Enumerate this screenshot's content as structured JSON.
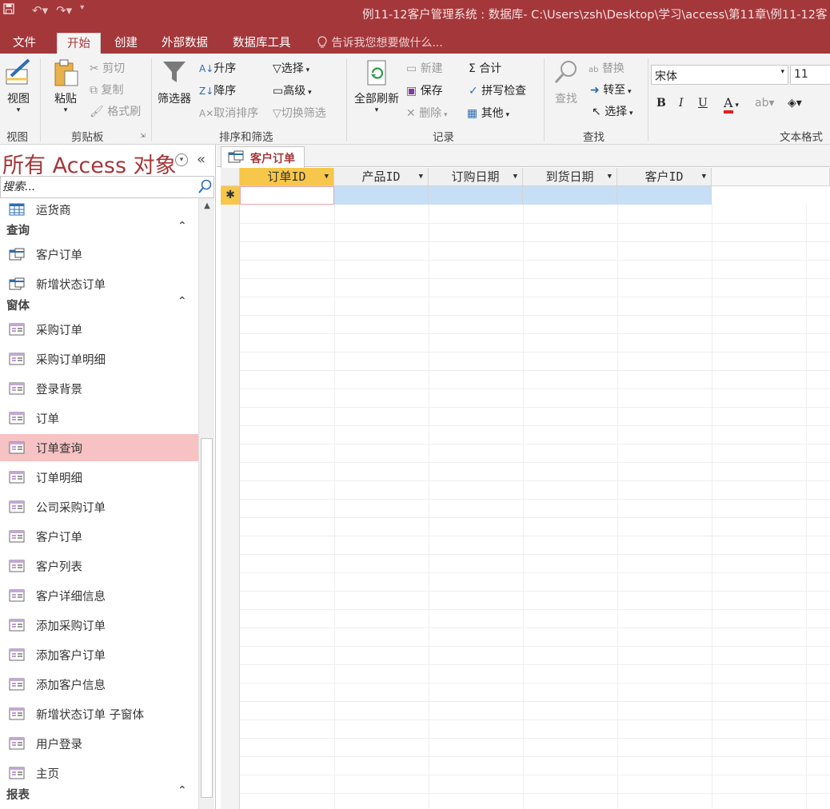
{
  "window": {
    "title": "例11-12客户管理系统 : 数据库- C:\\Users\\zsh\\Desktop\\学习\\access\\第11章\\例11-12客"
  },
  "tabs": [
    {
      "label": "文件"
    },
    {
      "label": "开始"
    },
    {
      "label": "创建"
    },
    {
      "label": "外部数据"
    },
    {
      "label": "数据库工具"
    }
  ],
  "tell_me": "告诉我您想要做什么...",
  "ribbon": {
    "view": {
      "label": "视图",
      "group": "视图"
    },
    "clipboard": {
      "paste": "粘贴",
      "cut": "剪切",
      "copy": "复制",
      "format_painter": "格式刷",
      "group": "剪贴板"
    },
    "sort_filter": {
      "filter": "筛选器",
      "ascending": "升序",
      "descending": "降序",
      "clear_sort": "取消排序",
      "selection": "选择",
      "advanced": "高级",
      "toggle_filter": "切换筛选",
      "group": "排序和筛选"
    },
    "records": {
      "refresh_all": "全部刷新",
      "new": "新建",
      "save": "保存",
      "delete": "删除",
      "totals": "合计",
      "spelling": "拼写检查",
      "more": "其他",
      "group": "记录"
    },
    "find": {
      "find": "查找",
      "replace": "替换",
      "goto": "转至",
      "select": "选择",
      "group": "查找"
    },
    "text_format": {
      "font": "宋体",
      "size": "11",
      "bold": "B",
      "italic": "I",
      "underline": "U",
      "font_color_letter": "A",
      "group": "文本格式"
    }
  },
  "nav": {
    "title": "所有 Access 对象",
    "collapse": "«",
    "search_placeholder": "搜索...",
    "top_item": "运货商",
    "sections": [
      {
        "header": "查询",
        "items": [
          "客户订单",
          "新增状态订单"
        ]
      },
      {
        "header": "窗体",
        "items": [
          "采购订单",
          "采购订单明细",
          "登录背景",
          "订单",
          "订单查询",
          "订单明细",
          "公司采购订单",
          "客户订单",
          "客户列表",
          "客户详细信息",
          "添加采购订单",
          "添加客户订单",
          "添加客户信息",
          "新增状态订单 子窗体",
          "用户登录",
          "主页"
        ]
      },
      {
        "header": "报表",
        "items": []
      }
    ],
    "selected_item": "订单查询"
  },
  "document": {
    "tab_label": "客户订单",
    "columns": [
      "订单ID",
      "产品ID",
      "订购日期",
      "到货日期",
      "客户ID"
    ],
    "new_record_marker": "✱"
  },
  "colors": {
    "accent": "#a4373a",
    "selected_nav": "#f6c2c3",
    "selected_header": "#f6c74a",
    "new_row": "#c6dff7"
  }
}
